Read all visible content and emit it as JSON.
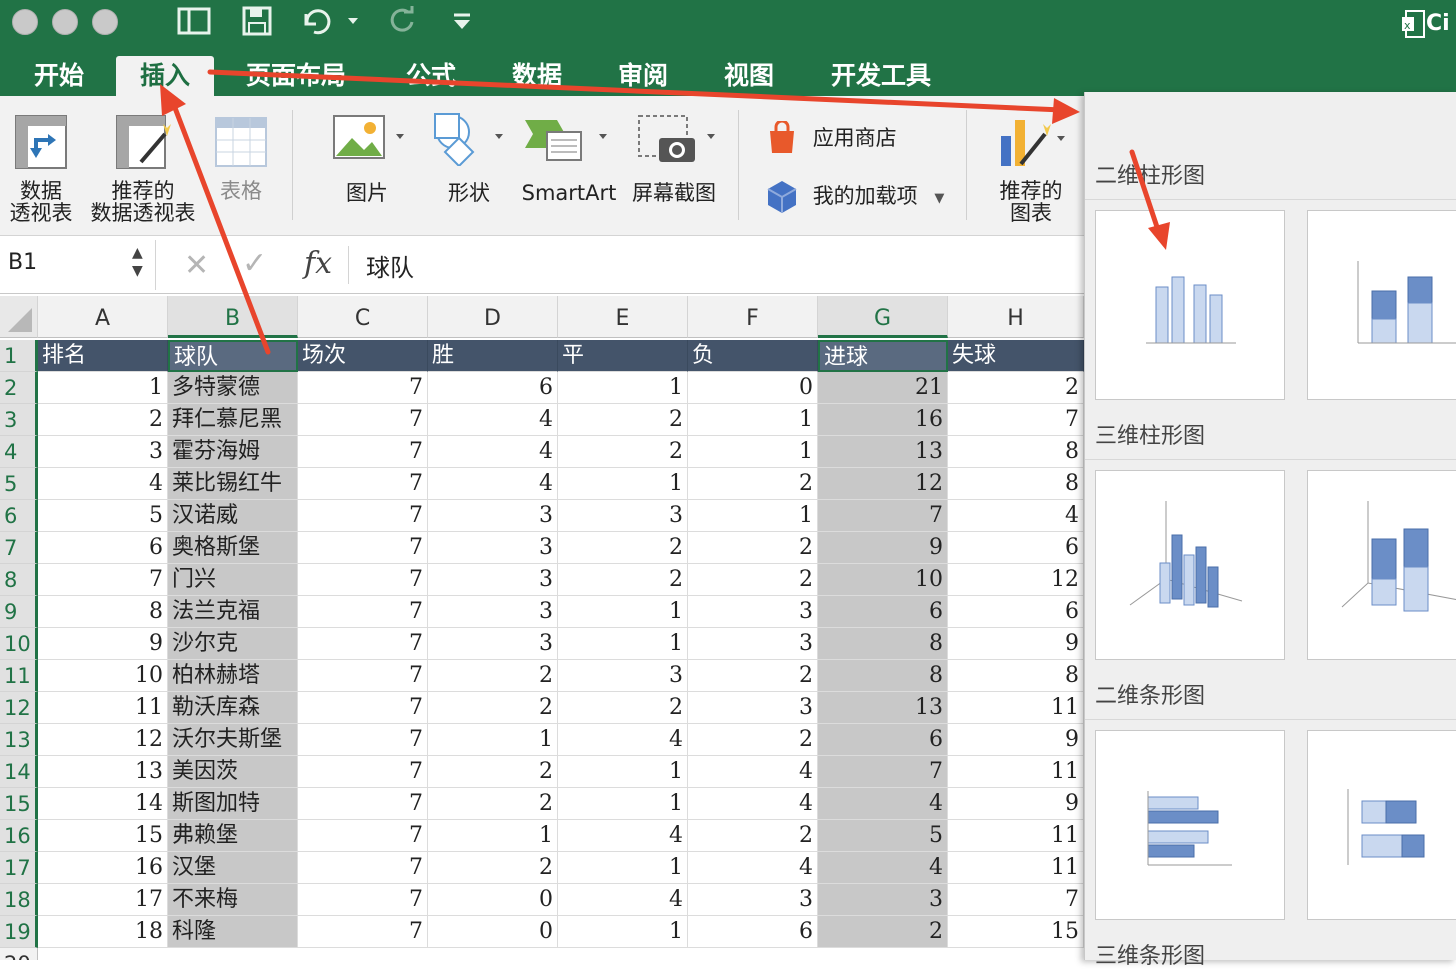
{
  "titlebar": {
    "window_controls": [
      "close",
      "minimize",
      "zoom"
    ],
    "app_badge": "Ci"
  },
  "tabs": [
    "开始",
    "插入",
    "页面布局",
    "公式",
    "数据",
    "审阅",
    "视图",
    "开发工具"
  ],
  "active_tab": "插入",
  "ribbon": {
    "pivot_line1": "数据",
    "pivot_line2": "透视表",
    "rec_pivot_line1": "推荐的",
    "rec_pivot_line2": "数据透视表",
    "table": "表格",
    "pictures": "图片",
    "shapes": "形状",
    "smartart": "SmartArt",
    "screenshot": "屏幕截图",
    "store": "应用商店",
    "addins": "我的加载项",
    "rec_charts_line1": "推荐的",
    "rec_charts_line2": "图表"
  },
  "formula_bar": {
    "name_box": "B1",
    "fx": "fx",
    "content": "球队"
  },
  "sheet": {
    "col_headers": [
      "A",
      "B",
      "C",
      "D",
      "E",
      "F",
      "G",
      "H"
    ],
    "header_row": [
      "排名",
      "球队",
      "场次",
      "胜",
      "平",
      "负",
      "进球",
      "失球"
    ],
    "rows": [
      [
        "1",
        "多特蒙德",
        "7",
        "6",
        "1",
        "0",
        "21",
        "2"
      ],
      [
        "2",
        "拜仁慕尼黑",
        "7",
        "4",
        "2",
        "1",
        "16",
        "7"
      ],
      [
        "3",
        "霍芬海姆",
        "7",
        "4",
        "2",
        "1",
        "13",
        "8"
      ],
      [
        "4",
        "莱比锡红牛",
        "7",
        "4",
        "1",
        "2",
        "12",
        "8"
      ],
      [
        "5",
        "汉诺威",
        "7",
        "3",
        "3",
        "1",
        "7",
        "4"
      ],
      [
        "6",
        "奥格斯堡",
        "7",
        "3",
        "2",
        "2",
        "9",
        "6"
      ],
      [
        "7",
        "门兴",
        "7",
        "3",
        "2",
        "2",
        "10",
        "12"
      ],
      [
        "8",
        "法兰克福",
        "7",
        "3",
        "1",
        "3",
        "6",
        "6"
      ],
      [
        "9",
        "沙尔克",
        "7",
        "3",
        "1",
        "3",
        "8",
        "9"
      ],
      [
        "10",
        "柏林赫塔",
        "7",
        "2",
        "3",
        "2",
        "8",
        "8"
      ],
      [
        "11",
        "勒沃库森",
        "7",
        "2",
        "2",
        "3",
        "13",
        "11"
      ],
      [
        "12",
        "沃尔夫斯堡",
        "7",
        "1",
        "4",
        "2",
        "6",
        "9"
      ],
      [
        "13",
        "美因茨",
        "7",
        "2",
        "1",
        "4",
        "7",
        "11"
      ],
      [
        "14",
        "斯图加特",
        "7",
        "2",
        "1",
        "4",
        "4",
        "9"
      ],
      [
        "15",
        "弗赖堡",
        "7",
        "1",
        "4",
        "2",
        "5",
        "11"
      ],
      [
        "16",
        "汉堡",
        "7",
        "2",
        "1",
        "4",
        "4",
        "11"
      ],
      [
        "17",
        "不来梅",
        "7",
        "0",
        "4",
        "3",
        "3",
        "7"
      ],
      [
        "18",
        "科隆",
        "7",
        "0",
        "1",
        "6",
        "2",
        "15"
      ]
    ]
  },
  "chart_panel": {
    "sections": [
      "二维柱形图",
      "三维柱形图",
      "二维条形图",
      "三维条形图"
    ]
  },
  "colors": {
    "excel_green": "#217346",
    "header_fill": "#44546a",
    "selection_fill": "#c8c8c8",
    "arrow": "#e8452c",
    "chart_blue": "#6b8ec7"
  }
}
